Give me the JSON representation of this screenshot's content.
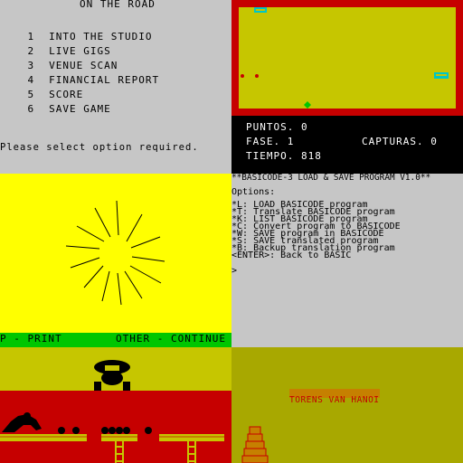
{
  "menu": {
    "title": "ON THE ROAD",
    "items": [
      {
        "num": "1",
        "label": "INTO THE STUDIO"
      },
      {
        "num": "2",
        "label": "LIVE GIGS"
      },
      {
        "num": "3",
        "label": "VENUE SCAN"
      },
      {
        "num": "4",
        "label": "FINANCIAL REPORT"
      },
      {
        "num": "5",
        "label": "SCORE"
      },
      {
        "num": "6",
        "label": "SAVE GAME"
      }
    ],
    "prompt": "Please select option required."
  },
  "arena": {
    "puntos": "PUNTOS. 0",
    "fase": "FASE. 1",
    "capturas": "CAPTURAS. 0",
    "tiempo": "TIEMPO. 818"
  },
  "sun": {
    "footer_left": "P - PRINT",
    "footer_right": "OTHER - CONTINUE"
  },
  "basicode": {
    "title": "**BASICODE-3 LOAD & SAVE PROGRAM V1.0**",
    "options_label": "Options:",
    "options": [
      "*L: LOAD BASICODE program",
      "*T: Translate BASICODE program",
      "*K: LIST BASICODE program",
      "*C: Convert program to BASICODE",
      "*W: SAVE program in BASICODE",
      "*S: SAVE translated program",
      "*B: Backup translation program",
      "<ENTER>: Back to BASIC"
    ],
    "cursor": ">"
  },
  "hanoi": {
    "title": "TORENS VAN HANOI"
  },
  "colors": {
    "grey": "#c6c6c6",
    "yellow": "#ffff00",
    "dark_yellow": "#c6c600",
    "red": "#c60000",
    "green": "#00c600",
    "black": "#000000"
  }
}
